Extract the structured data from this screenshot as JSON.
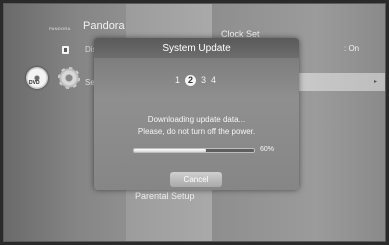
{
  "background_menu": {
    "brand_small": "PANDORA",
    "brand": "Pandora",
    "disc_label": "Disc",
    "settings_label": "Set",
    "dvd_icon_text": "DVD",
    "clock_set_label": "Clock Set",
    "clock_set_value": ": On",
    "row_arrow": "▸",
    "parental_setup_label": "Parental Setup"
  },
  "dialog": {
    "title": "System Update",
    "steps": [
      "1",
      "2",
      "3",
      "4"
    ],
    "active_step": 2,
    "message_line1": "Downloading update data...",
    "message_line2": "Please, do not turn off the power.",
    "progress_percent": 60,
    "progress_label": "60%",
    "cancel_label": "Cancel"
  },
  "colors": {
    "dialog_bg": "#8f8f8f",
    "progress_fill": "#ffffff",
    "highlight_row": "#c9c9c9"
  }
}
